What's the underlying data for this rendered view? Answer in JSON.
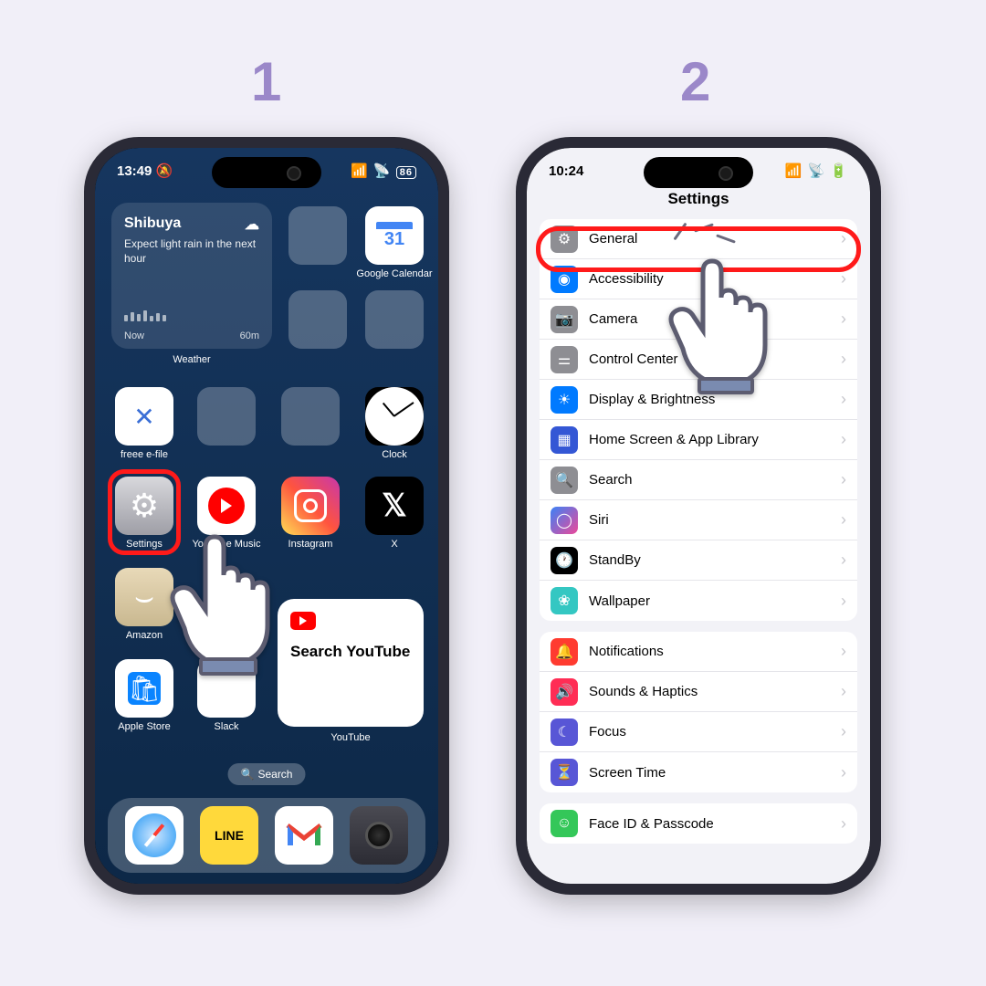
{
  "steps": {
    "one": "1",
    "two": "2"
  },
  "phone1": {
    "time": "13:49",
    "battery": "86",
    "weather": {
      "city": "Shibuya",
      "desc": "Expect light rain in the next hour",
      "now": "Now",
      "range": "60m",
      "label": "Weather"
    },
    "apps": {
      "gcal": "Google Calendar",
      "freee": "freee e-file",
      "clock": "Clock",
      "settings": "Settings",
      "ytmusic": "YouTube Music",
      "instagram": "Instagram",
      "x": "X",
      "amazon": "Amazon",
      "applestore": "Apple Store",
      "slack": "Slack",
      "youtube": "YouTube"
    },
    "yt_widget": "Search YouTube",
    "search": "Search",
    "cal_day": "31"
  },
  "phone2": {
    "time": "10:24",
    "title": "Settings",
    "rows": {
      "general": "General",
      "accessibility": "Accessibility",
      "camera": "Camera",
      "control": "Control Center",
      "display": "Display & Brightness",
      "home": "Home Screen & App Library",
      "search": "Search",
      "siri": "Siri",
      "standby": "StandBy",
      "wallpaper": "Wallpaper",
      "notifications": "Notifications",
      "sounds": "Sounds & Haptics",
      "focus": "Focus",
      "screentime": "Screen Time",
      "faceid": "Face ID & Passcode"
    }
  },
  "colors": {
    "grey": "#8e8e93",
    "blue": "#007aff",
    "red": "#ff3b30",
    "purple": "#5856d6",
    "teal": "#34c7c2",
    "green": "#34c759"
  }
}
